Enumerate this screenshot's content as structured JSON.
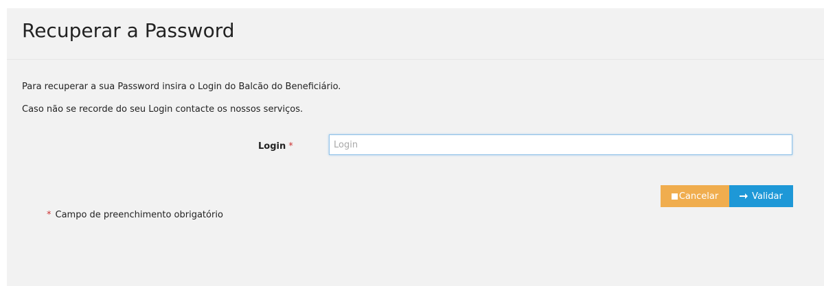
{
  "page": {
    "title": "Recuperar a Password"
  },
  "info": {
    "line1": "Para recuperar a sua Password insira o Login do Balcão do Beneficiário.",
    "line2": "Caso não se recorde do seu Login contacte os nossos serviços."
  },
  "form": {
    "login_label": "Login",
    "required_marker": "*",
    "login_value": "",
    "login_placeholder": "Login"
  },
  "actions": {
    "cancel_label": "Cancelar",
    "validate_label": "Validar",
    "cancel_icon": "stop-square-icon",
    "validate_icon": "arrow-right-icon"
  },
  "footnote": {
    "marker": "*",
    "text": "Campo de preenchimento obrigatório"
  },
  "colors": {
    "panel_background": "#f2f2f2",
    "cancel_button": "#f0ad4e",
    "validate_button": "#1e98d7",
    "required_marker": "#cc3333",
    "input_focus_border": "#8fc1e8"
  }
}
